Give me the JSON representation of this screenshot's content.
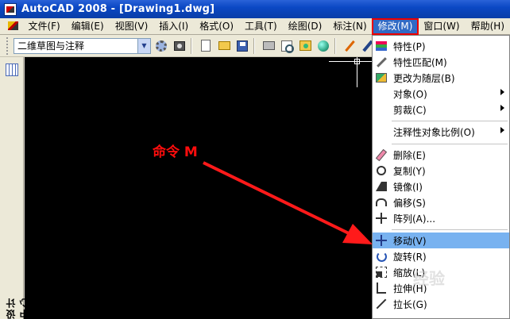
{
  "window": {
    "title": "AutoCAD 2008 - [Drawing1.dwg]"
  },
  "menubar": {
    "items": [
      "文件(F)",
      "编辑(E)",
      "视图(V)",
      "插入(I)",
      "格式(O)",
      "工具(T)",
      "绘图(D)",
      "标注(N)",
      "修改(M)",
      "窗口(W)",
      "帮助(H)"
    ],
    "active_index": 8,
    "active_highlight_color": "#316ac5",
    "annotation_box_color": "#e00000"
  },
  "toolbar": {
    "workspace_combo_value": "二维草图与注释",
    "icons": [
      "workspace-settings-icon",
      "workspace-camera-icon",
      "new-icon",
      "open-icon",
      "save-icon",
      "print-icon",
      "plot-preview-icon",
      "publish-icon",
      "globe-icon",
      "pencil-icon",
      "brush-icon"
    ]
  },
  "left_panel": {
    "design_center_label": "设计中心"
  },
  "canvas": {
    "background": "#000000",
    "annotation_text": "命令 M",
    "annotation_color": "#ff0d0d"
  },
  "modify_menu": {
    "items": [
      {
        "label": "特性(P)",
        "icon": "properties-icon"
      },
      {
        "label": "特性匹配(M)",
        "icon": "match-properties-icon"
      },
      {
        "label": "更改为随层(B)",
        "icon": "change-bylayer-icon"
      },
      {
        "label": "对象(O)",
        "submenu": true
      },
      {
        "label": "剪裁(C)",
        "submenu": true
      },
      {
        "label": "注释性对象比例(O)",
        "submenu": true
      },
      {
        "label": "删除(E)",
        "icon": "erase-icon"
      },
      {
        "label": "复制(Y)",
        "icon": "copy-icon"
      },
      {
        "label": "镜像(I)",
        "icon": "mirror-icon"
      },
      {
        "label": "偏移(S)",
        "icon": "offset-icon"
      },
      {
        "label": "阵列(A)...",
        "icon": "array-icon"
      },
      {
        "label": "移动(V)",
        "icon": "move-icon",
        "highlighted": true
      },
      {
        "label": "旋转(R)",
        "icon": "rotate-icon"
      },
      {
        "label": "缩放(L)",
        "icon": "scale-icon"
      },
      {
        "label": "拉伸(H)",
        "icon": "stretch-icon"
      },
      {
        "label": "拉长(G)",
        "icon": "lengthen-icon"
      }
    ],
    "highlight_color": "#78b2f0"
  },
  "watermark": {
    "text": "经验"
  }
}
